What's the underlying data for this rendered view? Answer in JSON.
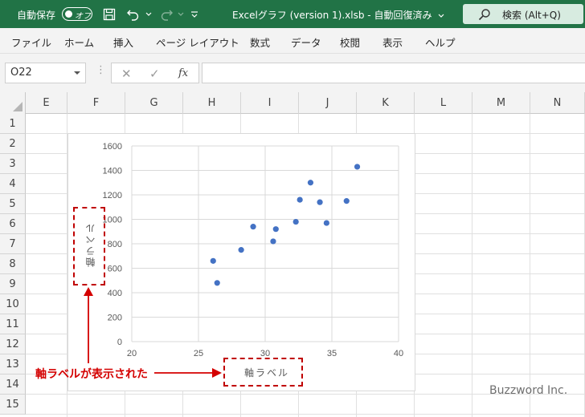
{
  "titlebar": {
    "autosave_label": "自動保存",
    "autosave_state": "オフ",
    "file_title": "Excelグラフ (version 1).xlsb  -  自動回復済み",
    "search_label": "検索 (Alt+Q)",
    "bg_color": "#217346",
    "icons": [
      "save-icon",
      "undo-icon",
      "redo-icon",
      "customize-icon",
      "search-icon"
    ]
  },
  "menu": {
    "items": [
      "ファイル",
      "ホーム",
      "挿入",
      "ページ レイアウト",
      "数式",
      "データ",
      "校閲",
      "表示",
      "ヘルプ"
    ]
  },
  "formula_bar": {
    "name_box": "O22",
    "cancel_symbol": "✕",
    "enter_symbol": "✓",
    "fx_symbol": "fx",
    "value": ""
  },
  "sheet": {
    "columns": [
      "E",
      "F",
      "G",
      "H",
      "I",
      "J",
      "K",
      "L",
      "M",
      "N"
    ],
    "rows": [
      "1",
      "2",
      "3",
      "4",
      "5",
      "6",
      "7",
      "8",
      "9",
      "10",
      "11",
      "12",
      "13",
      "14",
      "15"
    ]
  },
  "chart_data": {
    "type": "scatter",
    "title": "",
    "xlabel": "軸ラベル",
    "ylabel": "軸ラベル",
    "xlim": [
      20,
      40
    ],
    "ylim": [
      0,
      1600
    ],
    "x_ticks": [
      "20",
      "25",
      "30",
      "35",
      "40"
    ],
    "y_ticks": [
      "0",
      "200",
      "400",
      "600",
      "800",
      "1000",
      "1200",
      "1400",
      "1600"
    ],
    "grid": true,
    "marker_color": "#4472c4",
    "series": [
      {
        "points": [
          {
            "x": 26.1,
            "y": 660
          },
          {
            "x": 26.4,
            "y": 480
          },
          {
            "x": 28.2,
            "y": 750
          },
          {
            "x": 29.1,
            "y": 940
          },
          {
            "x": 30.6,
            "y": 820
          },
          {
            "x": 30.8,
            "y": 920
          },
          {
            "x": 32.3,
            "y": 980
          },
          {
            "x": 32.6,
            "y": 1160
          },
          {
            "x": 33.4,
            "y": 1300
          },
          {
            "x": 34.1,
            "y": 1140
          },
          {
            "x": 34.6,
            "y": 970
          },
          {
            "x": 36.1,
            "y": 1150
          },
          {
            "x": 36.9,
            "y": 1430
          }
        ]
      }
    ]
  },
  "annotation": {
    "text": "軸ラベルが表示された",
    "color": "#d40000"
  },
  "watermark": "Buzzword Inc."
}
